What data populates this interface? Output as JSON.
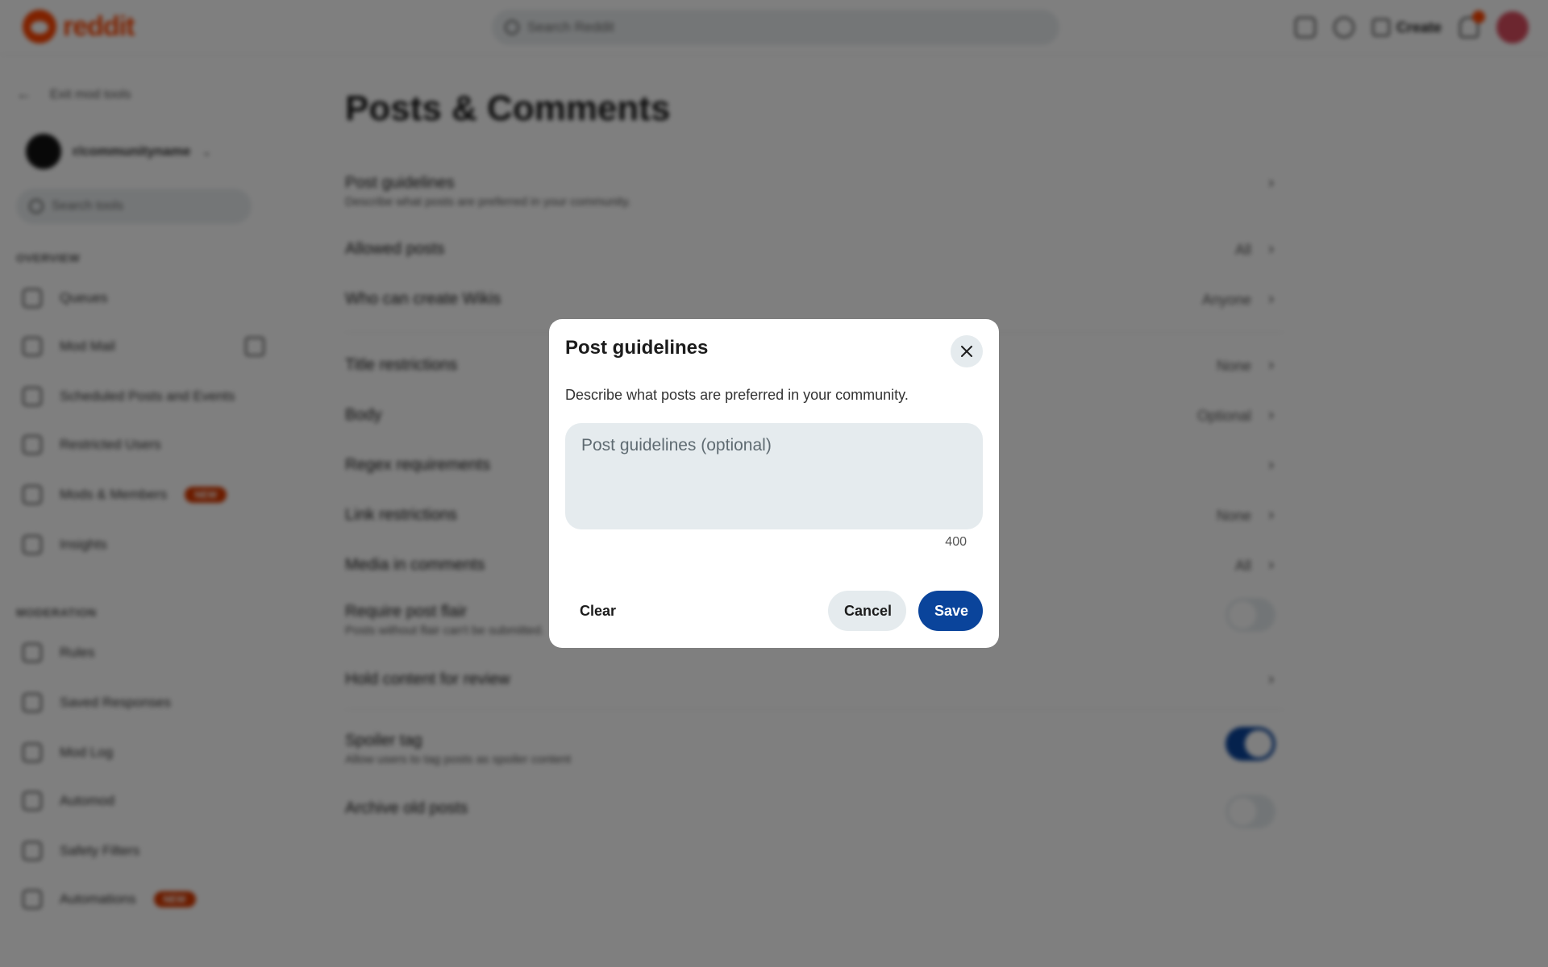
{
  "topbar": {
    "logo_text": "reddit",
    "search_placeholder": "Search Reddit",
    "create_label": "Create"
  },
  "sidebar": {
    "back_label": "Exit mod tools",
    "community_name": "r/communityname",
    "search_tools_placeholder": "Search tools",
    "sections": [
      {
        "heading": "OVERVIEW",
        "items": [
          {
            "label": "Queues"
          },
          {
            "label": "Mod Mail"
          },
          {
            "label": "Scheduled Posts and Events"
          },
          {
            "label": "Restricted Users"
          },
          {
            "label": "Mods & Members",
            "badge": "NEW"
          },
          {
            "label": "Insights"
          }
        ]
      },
      {
        "heading": "MODERATION",
        "items": [
          {
            "label": "Rules"
          },
          {
            "label": "Saved Responses"
          },
          {
            "label": "Mod Log"
          },
          {
            "label": "Automod"
          },
          {
            "label": "Safety Filters"
          },
          {
            "label": "Automations",
            "badge": "NEW"
          }
        ]
      }
    ]
  },
  "main": {
    "page_title": "Posts & Comments",
    "settings": [
      {
        "label": "Post guidelines",
        "desc": "Describe what posts are preferred in your community.",
        "value": "",
        "control": "chevron"
      },
      {
        "label": "Allowed posts",
        "value": "All",
        "control": "chevron"
      },
      {
        "label": "Who can create Wikis",
        "value": "Anyone",
        "control": "chevron"
      },
      {
        "label": "Title restrictions",
        "value": "None",
        "control": "chevron"
      },
      {
        "label": "Body",
        "value": "Optional",
        "control": "chevron"
      },
      {
        "label": "Regex requirements",
        "value": "",
        "control": "chevron"
      },
      {
        "label": "Link restrictions",
        "value": "None",
        "control": "chevron"
      },
      {
        "label": "Media in comments",
        "value": "All",
        "control": "chevron"
      },
      {
        "label": "Require post flair",
        "desc": "Posts without flair can't be submitted.",
        "control": "toggle",
        "on": false
      },
      {
        "label": "Hold content for review",
        "value": "",
        "control": "chevron"
      },
      {
        "label": "Spoiler tag",
        "desc": "Allow users to tag posts as spoiler content",
        "control": "toggle",
        "on": true
      },
      {
        "label": "Archive old posts",
        "control": "toggle",
        "on": false
      }
    ]
  },
  "modal": {
    "title": "Post guidelines",
    "description": "Describe what posts are preferred in your community.",
    "textarea_placeholder": "Post guidelines (optional)",
    "textarea_value": "",
    "char_count": "400",
    "clear_label": "Clear",
    "cancel_label": "Cancel",
    "save_label": "Save"
  },
  "colors": {
    "brand": "#ff4500",
    "primary_button": "#0a449b",
    "secondary_button": "#e5ebee",
    "overlay": "rgba(0,0,0,0.5)"
  }
}
